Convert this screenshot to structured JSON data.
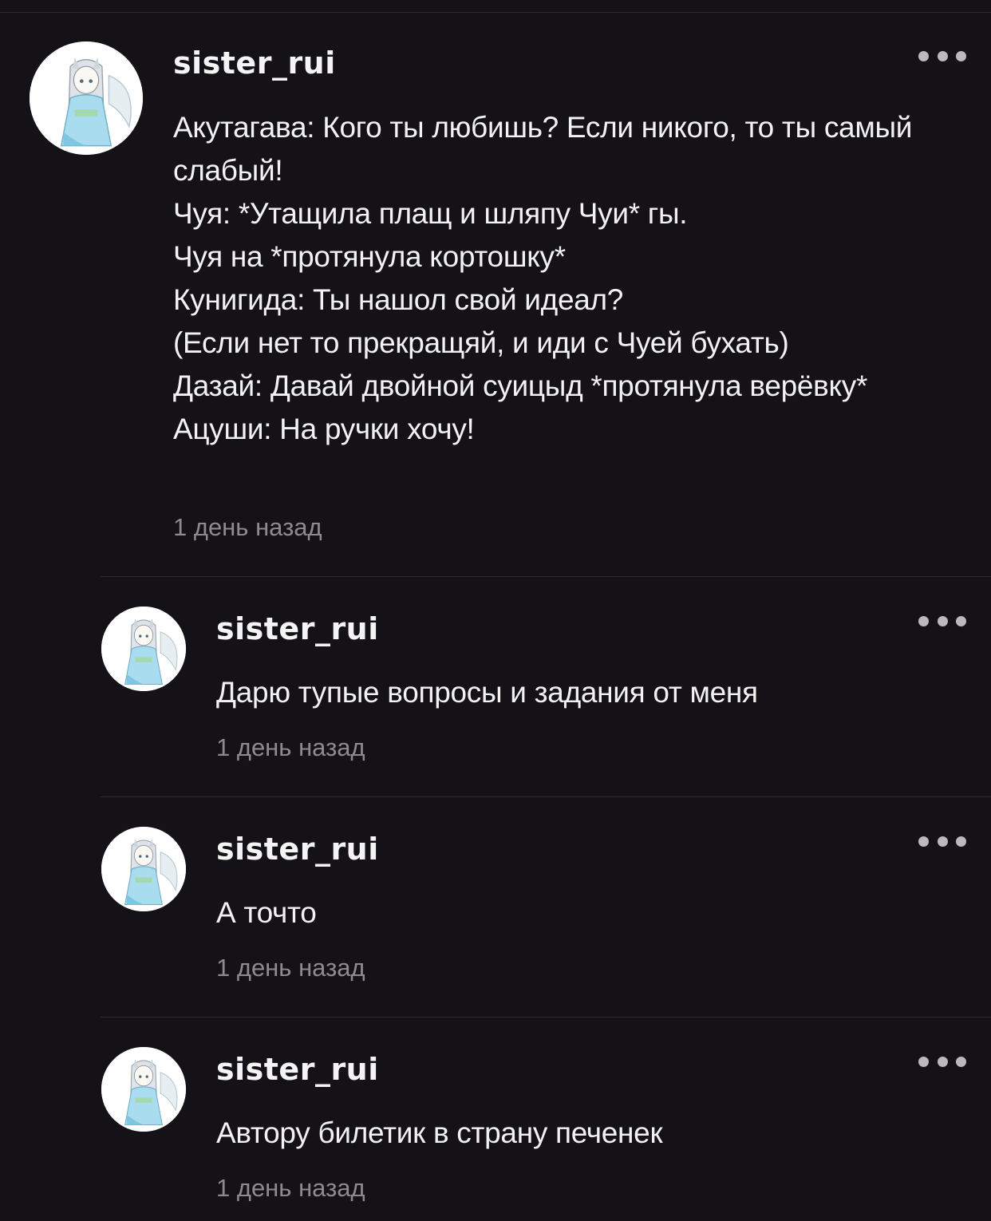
{
  "comments": [
    {
      "username": "sister_rui",
      "text": "Акутагава: Кого ты любишь? Если никого, то ты самый слабый!\nЧуя: *Утащила плащ и шляпу Чуи* гы.\nЧуя на *протянула кортошку*\nКунигида: Ты нашол свой идеал?\n(Если нет то прекращяй, и иди с Чуей бухать)\nДазай: Давай двойной суицыд *протянула верёвку*\nАцуши: На ручки хочу!",
      "time": "1 день назад",
      "avatar_icon": "anime-fox-girl-avatar",
      "more_icon": "ellipsis-icon"
    },
    {
      "username": "sister_rui",
      "text": "Дарю тупые вопросы и задания от меня",
      "time": "1 день назад",
      "avatar_icon": "anime-fox-girl-avatar",
      "more_icon": "ellipsis-icon"
    },
    {
      "username": "sister_rui",
      "text": "А точто",
      "time": "1 день назад",
      "avatar_icon": "anime-fox-girl-avatar",
      "more_icon": "ellipsis-icon"
    },
    {
      "username": "sister_rui",
      "text": "Автору билетик в страну печенек",
      "time": "1 день назад",
      "avatar_icon": "anime-fox-girl-avatar",
      "more_icon": "ellipsis-icon"
    }
  ],
  "colors": {
    "background": "#141216",
    "text": "#f2f2f2",
    "muted": "#8d8a90",
    "divider": "#2e2c31"
  }
}
